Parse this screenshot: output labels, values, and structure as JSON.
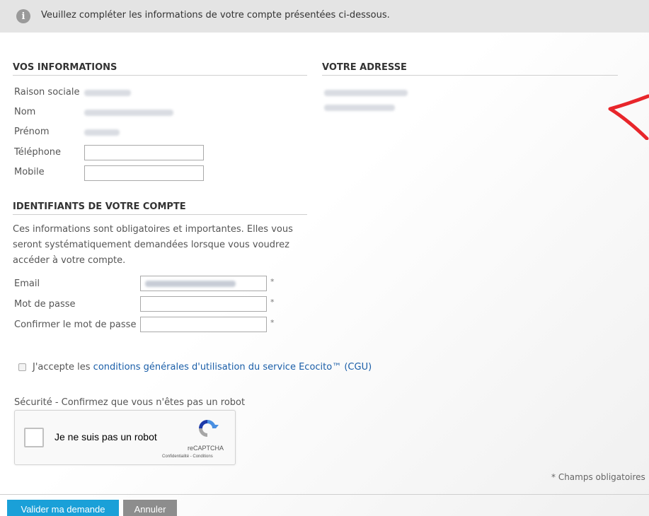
{
  "notice": {
    "icon": "info-icon",
    "text": "Veuillez compléter les informations de votre compte présentées ci-dessous."
  },
  "vos_informations": {
    "title": "VOS INFORMATIONS",
    "raison_sociale_label": "Raison sociale",
    "nom_label": "Nom",
    "prenom_label": "Prénom",
    "telephone_label": "Téléphone",
    "mobile_label": "Mobile"
  },
  "adresse": {
    "title": "VOTRE ADRESSE"
  },
  "identifiants": {
    "title": "IDENTIFIANTS DE VOTRE COMPTE",
    "description": "Ces informations sont obligatoires et importantes. Elles vous seront systématiquement demandées lorsque vous voudrez accéder à votre compte.",
    "email_label": "Email",
    "password_label": "Mot de passe",
    "confirm_label": "Confirmer le mot de passe",
    "required_marker": "*"
  },
  "cgu": {
    "prefix": "J'accepte les ",
    "link": "conditions générales d'utilisation du service Ecocito™ (CGU)"
  },
  "security": {
    "label": "Sécurité - Confirmez que vous n'êtes pas un robot",
    "recaptcha_label": "Je ne suis pas un robot",
    "recaptcha_brand": "reCAPTCHA",
    "recaptcha_links": "Confidentialité - Conditions"
  },
  "required_note": "* Champs obligatoires",
  "buttons": {
    "submit": "Valider ma demande",
    "cancel": "Annuler"
  },
  "colors": {
    "primary_button": "#1aa0d8",
    "secondary_button": "#8d8d8d",
    "link": "#1a5ea8",
    "annotation_arrow": "#e8262b"
  }
}
